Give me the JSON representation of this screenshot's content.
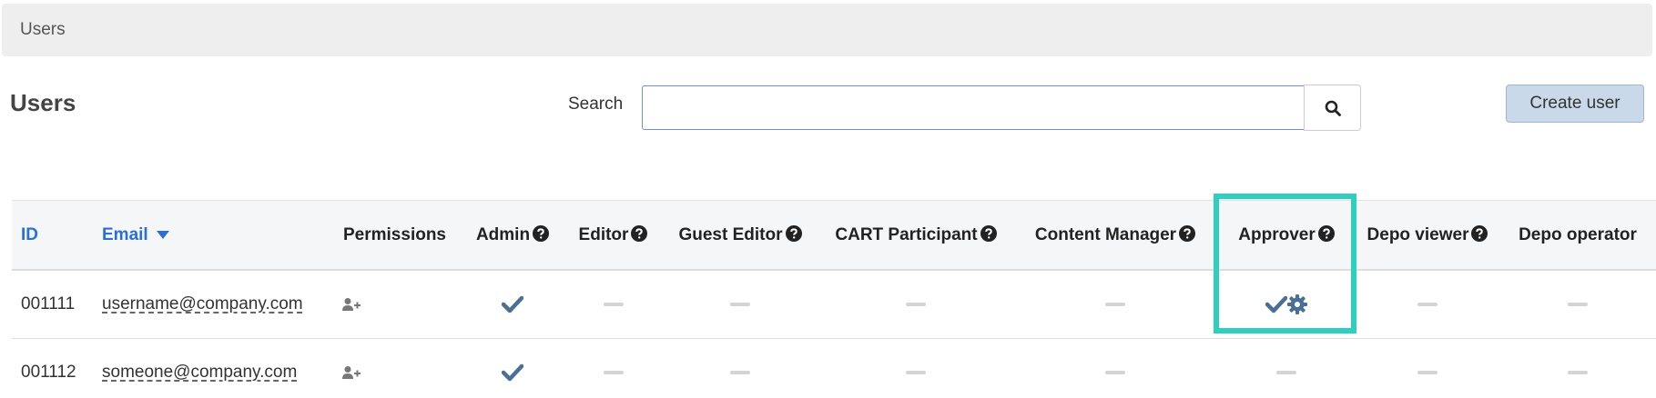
{
  "breadcrumb": {
    "label": "Users"
  },
  "page": {
    "title": "Users"
  },
  "search": {
    "label": "Search",
    "value": "",
    "placeholder": ""
  },
  "actions": {
    "create_user_label": "Create user"
  },
  "table": {
    "columns": {
      "id": "ID",
      "email": "Email",
      "permissions": "Permissions",
      "admin": "Admin",
      "editor": "Editor",
      "guest_editor": "Guest Editor",
      "cart_participant": "CART Participant",
      "content_manager": "Content Manager",
      "approver": "Approver",
      "depo_viewer": "Depo viewer",
      "depo_operator": "Depo operator"
    },
    "sort": {
      "column": "Email",
      "direction": "descending"
    },
    "rows": [
      {
        "id": "001111",
        "email": "username@company.com",
        "admin": true,
        "editor": false,
        "guest_editor": false,
        "cart_participant": false,
        "content_manager": false,
        "approver": true,
        "approver_settings": true,
        "depo_viewer": false,
        "depo_operator": false
      },
      {
        "id": "001112",
        "email": "someone@company.com",
        "admin": true,
        "editor": false,
        "guest_editor": false,
        "cart_participant": false,
        "content_manager": false,
        "approver": false,
        "approver_settings": false,
        "depo_viewer": false,
        "depo_operator": false
      }
    ]
  },
  "colors": {
    "link": "#2b6fd6",
    "check": "#4a6f96",
    "highlight": "#2ecfbe",
    "primary_button": "#c9d9ea",
    "dash": "#d4d4d4"
  },
  "icons": {
    "search": "search-icon",
    "help": "question-circle-icon",
    "check": "check-icon",
    "settings": "gear-icon",
    "add_user": "user-plus-icon",
    "sort": "caret-down-icon"
  }
}
